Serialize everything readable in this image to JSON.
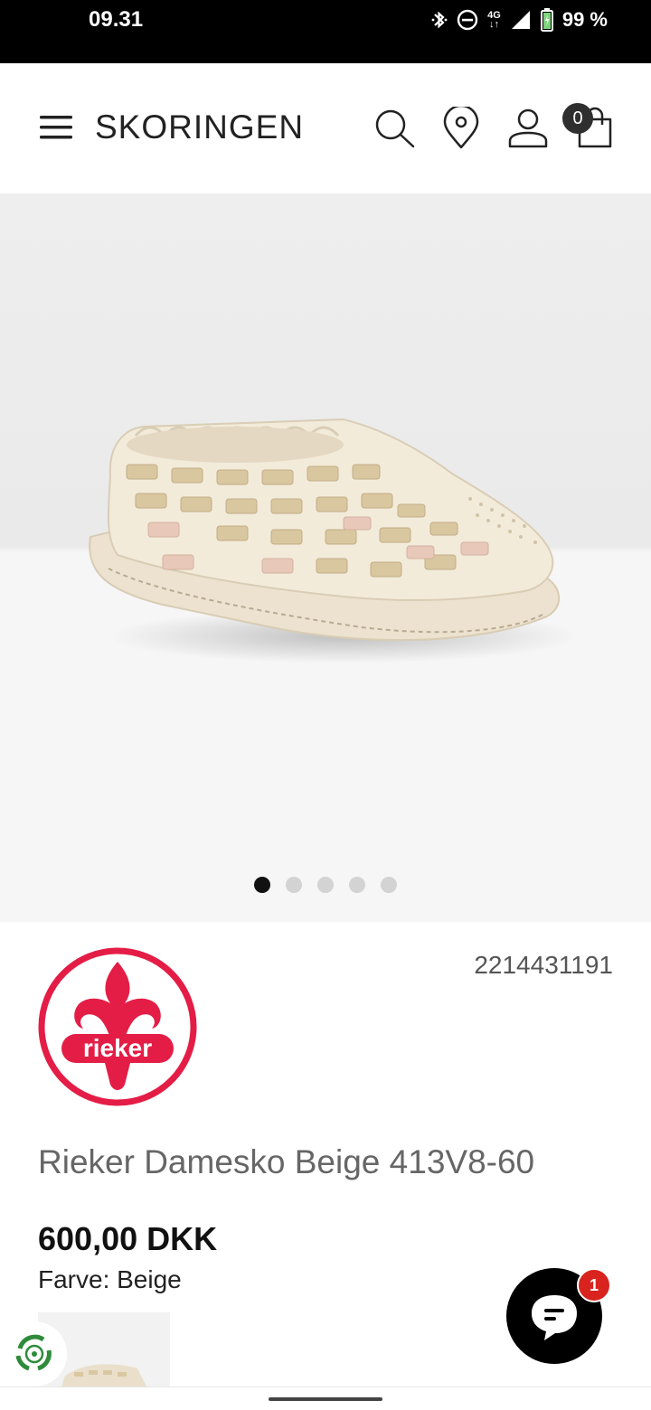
{
  "status_bar": {
    "time": "09.31",
    "network": "4G",
    "battery": "99 %",
    "icons": [
      "bluetooth-icon",
      "do-not-disturb-icon",
      "signal-icon",
      "battery-icon"
    ]
  },
  "header": {
    "logo": "SKORINGEN",
    "cart_count": "0",
    "icons": [
      "menu-icon",
      "search-icon",
      "location-pin-icon",
      "user-icon",
      "shopping-bag-icon"
    ]
  },
  "gallery": {
    "image_count": 5,
    "active_index": 0
  },
  "product": {
    "brand": "rieker",
    "sku": "2214431191",
    "name": "Rieker Damesko Beige 413V8-60",
    "price": "600,00 DKK",
    "color": "Farve: Beige"
  },
  "chat": {
    "unread_count": "1"
  },
  "colors": {
    "brand_red": "#e41d46",
    "badge_red": "#d8231e",
    "text_gray": "#666666"
  }
}
